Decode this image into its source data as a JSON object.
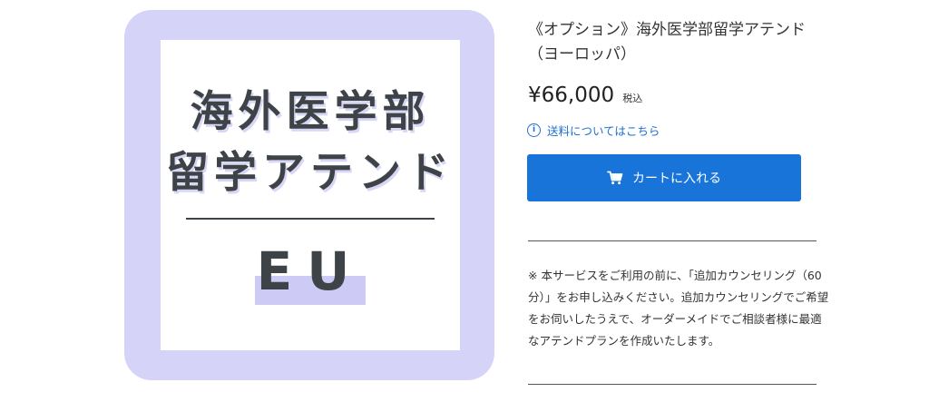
{
  "product_image": {
    "line1": "海外医学部",
    "line2": "留学アテンド",
    "region": "EU"
  },
  "product": {
    "title": "《オプション》海外医学部留学アテンド（ヨーロッパ）",
    "price": "¥66,000",
    "tax_label": "税込",
    "shipping_info_link": "送料についてはこちら",
    "cart_button_label": "カートに入れる",
    "notice": "※ 本サービスをご利用の前に、「追加カウンセリング（60分）」をお申し込みください。追加カウンセリングでご希望をお伺いしたうえで、オーダーメイドでご相談者様に最適なアテンドプランを作成いたします。"
  },
  "colors": {
    "accent": "#1874d9",
    "image_frame": "#d5d3f8",
    "link": "#1f6fd1"
  },
  "icons": {
    "info": "info-circle-icon",
    "cart": "cart-icon"
  }
}
